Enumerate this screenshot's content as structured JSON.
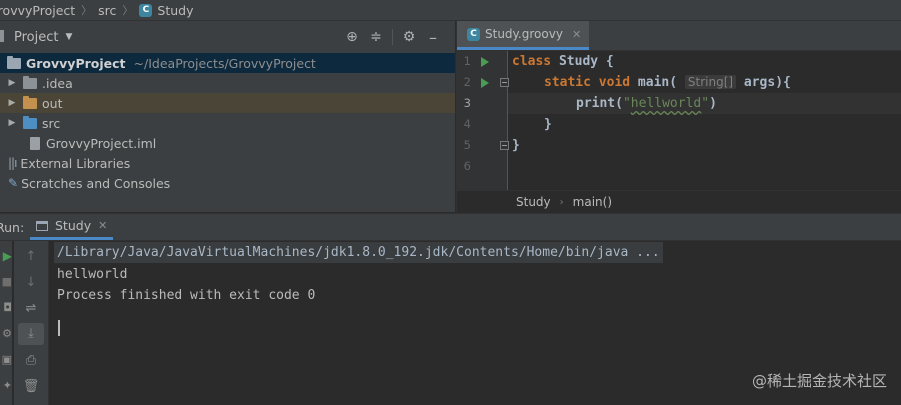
{
  "breadcrumb": {
    "project": "GrovvyProject",
    "folder": "src",
    "file": "Study"
  },
  "project_panel": {
    "title": "Project",
    "tree": [
      {
        "label": "GrovvyProject",
        "path": "~/IdeaProjects/GrovvyProject",
        "expanded": true
      },
      {
        "label": ".idea"
      },
      {
        "label": "out"
      },
      {
        "label": "src"
      },
      {
        "label": "GrovvyProject.iml"
      },
      {
        "label": "External Libraries"
      },
      {
        "label": "Scratches and Consoles"
      }
    ]
  },
  "editor": {
    "tab_label": "Study.groovy",
    "line_numbers": [
      "1",
      "2",
      "3",
      "4",
      "5",
      "6"
    ],
    "code": {
      "l1_kw": "class",
      "l1_name": " Study {",
      "l2_kw": "static void",
      "l2_rest": " main(",
      "l2_hint": "String[]",
      "l2_tail": " args){",
      "l3_pre": "print(",
      "l3_str_q1": "\"",
      "l3_str_word": "hellworld",
      "l3_str_q2": "\"",
      "l3_post": ")",
      "l4": "}",
      "l5": "}"
    },
    "breadcrumb": [
      "Study",
      "main()"
    ]
  },
  "run_panel": {
    "label": "Run:",
    "tab_label": "Study",
    "console": [
      "/Library/Java/JavaVirtualMachines/jdk1.8.0_192.jdk/Contents/Home/bin/java ...",
      "hellworld",
      "Process finished with exit code 0"
    ]
  },
  "watermark": "@稀土掘金技术社区",
  "colors": {
    "keyword": "#cc7832",
    "string": "#6a8759",
    "accent": "#4a88c7",
    "run_green": "#499c54"
  }
}
